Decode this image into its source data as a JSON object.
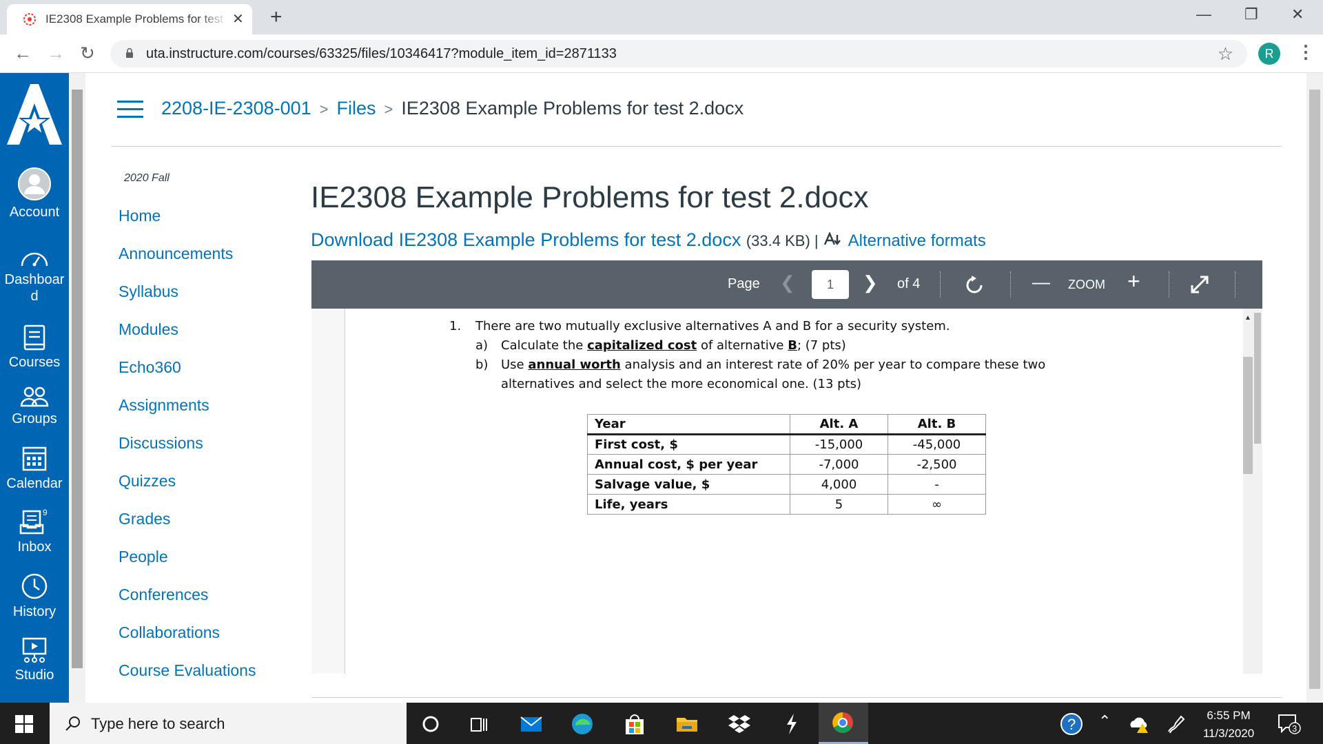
{
  "browser": {
    "tab_title": "IE2308 Example Problems for test 2.docx",
    "new_tab": "+",
    "close_tab": "✕",
    "url": "uta.instructure.com/courses/63325/files/10346417?module_item_id=2871133",
    "profile_initial": "R"
  },
  "global_nav": {
    "items": [
      {
        "label": "Account",
        "icon": "account-icon"
      },
      {
        "label": "Dashboard",
        "icon": "dashboard-icon"
      },
      {
        "label": "Courses",
        "icon": "courses-icon"
      },
      {
        "label": "Groups",
        "icon": "groups-icon"
      },
      {
        "label": "Calendar",
        "icon": "calendar-icon"
      },
      {
        "label": "Inbox",
        "icon": "inbox-icon",
        "badge": "9"
      },
      {
        "label": "History",
        "icon": "history-icon"
      },
      {
        "label": "Studio",
        "icon": "studio-icon"
      }
    ]
  },
  "breadcrumb": {
    "course": "2208-IE-2308-001",
    "section": "Files",
    "current": "IE2308 Example Problems for test 2.docx",
    "separator": ">"
  },
  "course_nav": {
    "term": "2020 Fall",
    "items": [
      "Home",
      "Announcements",
      "Syllabus",
      "Modules",
      "Echo360",
      "Assignments",
      "Discussions",
      "Quizzes",
      "Grades",
      "People",
      "Conferences",
      "Collaborations",
      "Course Evaluations"
    ]
  },
  "content": {
    "title": "IE2308 Example Problems for test 2.docx",
    "download_link": "Download IE2308 Example Problems for test 2.docx",
    "file_size": "(33.4 KB) |",
    "alt_formats": "Alternative formats"
  },
  "viewer": {
    "page_label": "Page",
    "page_value": "1",
    "page_total": "of 4",
    "zoom_label": "ZOOM"
  },
  "document": {
    "q_num": "1.",
    "q_text": "There are two mutually exclusive alternatives A and B for a security system.",
    "a_label": "a)",
    "a_pre": "Calculate the ",
    "a_u1": "capitalized cost",
    "a_mid": " of alternative ",
    "a_u2": "B",
    "a_post": "; (7 pts)",
    "b_label": "b)",
    "b_pre": "Use ",
    "b_u1": "annual worth",
    "b_post": " analysis and an interest rate of 20% per year to compare these two",
    "b_line2": "alternatives and select the more economical one. (13 pts)",
    "table": [
      [
        "Year",
        "Alt. A",
        "Alt. B"
      ],
      [
        "First cost, $",
        "-15,000",
        "-45,000"
      ],
      [
        "Annual cost, $ per year",
        "-7,000",
        "-2,500"
      ],
      [
        "Salvage value, $",
        "4,000",
        "-"
      ],
      [
        "Life, years",
        "5",
        "∞"
      ]
    ]
  },
  "taskbar": {
    "search_placeholder": "Type here to search",
    "time": "6:55 PM",
    "date": "11/3/2020",
    "notification_count": "3"
  },
  "colors": {
    "canvas_blue": "#0065b3",
    "link_blue": "#0374b5",
    "viewer_toolbar": "#59626a"
  }
}
